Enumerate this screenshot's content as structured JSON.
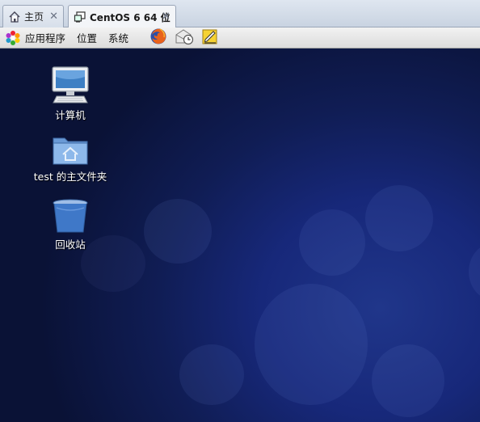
{
  "tabs": [
    {
      "label": "主页",
      "icon": "home-icon"
    },
    {
      "label": "CentOS 6 64 位",
      "icon": "vm-icon"
    }
  ],
  "panel": {
    "menus": [
      "应用程序",
      "位置",
      "系统"
    ],
    "launchers": [
      "firefox-icon",
      "mail-clock-icon",
      "notes-edit-icon"
    ]
  },
  "desktop": {
    "icons": [
      {
        "label": "计算机",
        "icon": "computer-icon"
      },
      {
        "label": "test 的主文件夹",
        "icon": "home-folder-icon"
      },
      {
        "label": "回收站",
        "icon": "trash-icon"
      }
    ]
  }
}
